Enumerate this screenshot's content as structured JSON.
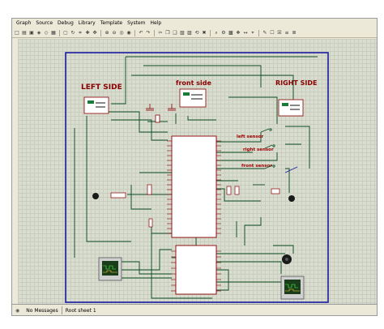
{
  "menu": {
    "items": [
      "Graph",
      "Source",
      "Debug",
      "Library",
      "Template",
      "System",
      "Help"
    ]
  },
  "toolbar": {
    "icons": [
      "new-icon",
      "open-icon",
      "save-icon",
      "import-icon",
      "export-icon",
      "print-icon",
      "area-icon",
      "refresh-icon",
      "grid-icon",
      "origin-icon",
      "pan-icon",
      "zoom-in-icon",
      "zoom-out-icon",
      "zoom-all-icon",
      "zoom-area-icon",
      "undo-icon",
      "redo-icon",
      "cut-icon",
      "copy-icon",
      "paste-icon",
      "block-copy-icon",
      "block-move-icon",
      "block-rotate-icon",
      "block-delete-icon",
      "pick-icon",
      "make-device-icon",
      "packaging-icon",
      "decompose-icon",
      "wire-autorouter-icon",
      "search-tag-icon",
      "property-assign-icon",
      "new-sheet-icon",
      "remove-sheet-icon",
      "netlist-icon",
      "bill-icon"
    ]
  },
  "schematic": {
    "headings": {
      "left": "LEFT SIDE",
      "front": "front side",
      "right": "RIGHT SIDE"
    },
    "sensor_labels": {
      "left": "left sensor",
      "right": "right sensor",
      "front": "front sensor"
    },
    "colors": {
      "heading": "#8b0000",
      "sensor_label": "#a00000",
      "wire": "#0b4b1f",
      "sheet_border": "#1a1aa0",
      "chip_fill": "#ffffff",
      "chip_border": "#8b0000",
      "scope_screen": "#1a3d1a"
    }
  },
  "status": {
    "messages": "No Messages",
    "sheet": "Root sheet 1"
  }
}
